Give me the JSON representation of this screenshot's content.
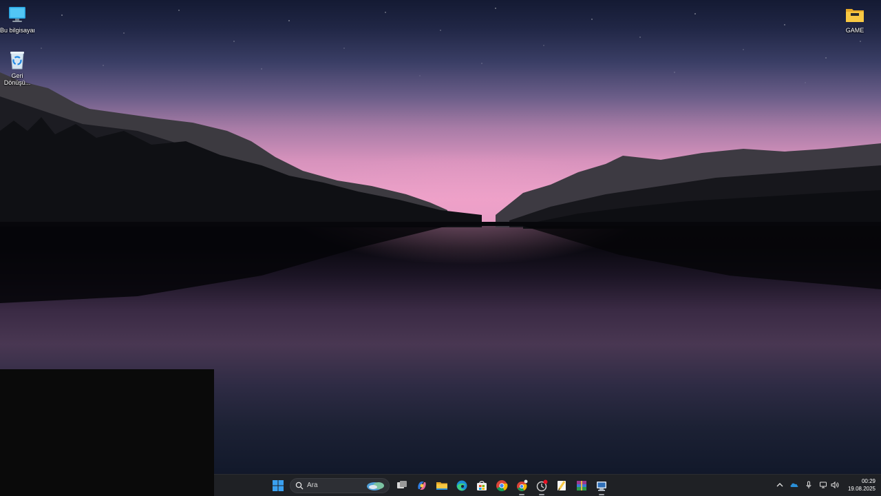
{
  "desktop": {
    "icons": [
      {
        "label": "Bu bilgisayar",
        "icon": "monitor-icon"
      },
      {
        "label": "Geri Dönüşü...",
        "icon": "recycle-bin-icon"
      },
      {
        "label": "GAME",
        "icon": "folder-icon"
      }
    ]
  },
  "taskbar": {
    "search_placeholder": "Ara",
    "apps": [
      {
        "name": "start",
        "icon": "windows-start-icon"
      },
      {
        "name": "task-view",
        "icon": "task-view-icon"
      },
      {
        "name": "copilot",
        "icon": "copilot-icon"
      },
      {
        "name": "file-explorer",
        "icon": "folder-icon"
      },
      {
        "name": "edge",
        "icon": "edge-icon"
      },
      {
        "name": "store",
        "icon": "store-icon"
      },
      {
        "name": "chrome",
        "icon": "chrome-icon"
      },
      {
        "name": "chrome-profile",
        "icon": "chrome-profile-icon"
      },
      {
        "name": "steam-like",
        "icon": "app-badge-icon"
      },
      {
        "name": "notes",
        "icon": "notepad-icon"
      },
      {
        "name": "winrar",
        "icon": "winrar-icon"
      },
      {
        "name": "remote-desktop",
        "icon": "remote-desktop-icon"
      }
    ],
    "clock": {
      "time": "00:29",
      "date": "19.08.2025"
    }
  },
  "colors": {
    "taskbar_bg": "#1f2125",
    "accent": "#0078d4"
  }
}
